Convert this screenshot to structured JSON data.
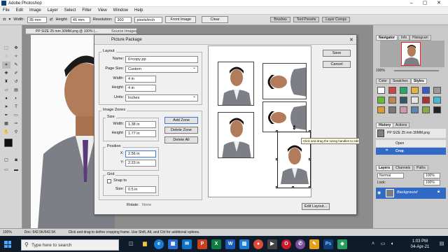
{
  "app": {
    "title": "Adobe Photoshop"
  },
  "menu": [
    "File",
    "Edit",
    "Image",
    "Layer",
    "Select",
    "Filter",
    "View",
    "Window",
    "Help"
  ],
  "options_bar": {
    "width_label": "Width:",
    "width_value": "35 mm",
    "height_label": "Height:",
    "height_value": "45 mm",
    "resolution_label": "Resolution:",
    "resolution_value": "300",
    "resolution_unit": "pixels/inch",
    "front_image": "Front Image",
    "clear": "Clear",
    "panel_tabs": [
      "Brushes",
      "Tool Presets",
      "Layer Comps"
    ]
  },
  "document": {
    "tab_title": "PP SIZE 25 mm 30MM.png @ 100% (..."
  },
  "dialog": {
    "title": "Picture Package",
    "source_images": "Source Images",
    "layout_group": "Layout",
    "name_label": "Name:",
    "name_value": "6×copy pp",
    "page_size_label": "Page Size:",
    "page_size_value": "Custom",
    "width_label": "Width:",
    "width_value": "4 in",
    "height_label": "Height:",
    "height_value": "4 in",
    "units_label": "Units:",
    "units_value": "Inches",
    "zones_group": "Image Zones",
    "size_group": "Size",
    "zone_width_label": "Width:",
    "zone_width_value": "1.38 in",
    "zone_height_label": "Height:",
    "zone_height_value": "1.77 in",
    "position_group": "Position",
    "x_label": "X:",
    "x_value": "2.56 in",
    "y_label": "Y:",
    "y_value": "2.23 in",
    "grid_group": "Grid",
    "snap_label": "Snap to",
    "grid_size_label": "Size:",
    "grid_size_value": "0.5 in",
    "add_zone": "Add Zone",
    "delete_zone": "Delete Zone",
    "delete_all": "Delete All",
    "save": "Save",
    "cancel": "Cancel",
    "rotate_label": "Rotate:",
    "rotate_value": "None",
    "edit_layout": "Edit Layout...",
    "tooltip": "Click and drag the sizing handles to edit"
  },
  "panels": {
    "navigator_tabs": [
      "Navigator",
      "Info",
      "Histogram"
    ],
    "zoom": "100%",
    "color_tabs": [
      "Color",
      "Swatches",
      "Styles"
    ],
    "history_tabs": [
      "History",
      "Actions"
    ],
    "history_items": [
      "PP SIZE 25 mm 30MM.png",
      "Open",
      "Crop"
    ],
    "layers_tabs": [
      "Layers",
      "Channels",
      "Paths"
    ],
    "blend_mode": "Normal",
    "opacity": "100%",
    "fill": "100%",
    "lock_label": "Lock:",
    "layer_name": "Background"
  },
  "status_bar": {
    "zoom": "100%",
    "doc": "Doc: 642.5K/642.5K",
    "hint": "Click and drag to define cropping frame. Use Shift, Alt, and Ctrl for additional options."
  },
  "taskbar": {
    "search_placeholder": "Type here to search",
    "time": "1:03 PM",
    "date": "04-Apr-21"
  },
  "colors": {
    "accent": "#3b7ad6",
    "taskbar": "#0d1b2a",
    "selected_row": "#3169c6",
    "layer_row": "#316ac5"
  }
}
